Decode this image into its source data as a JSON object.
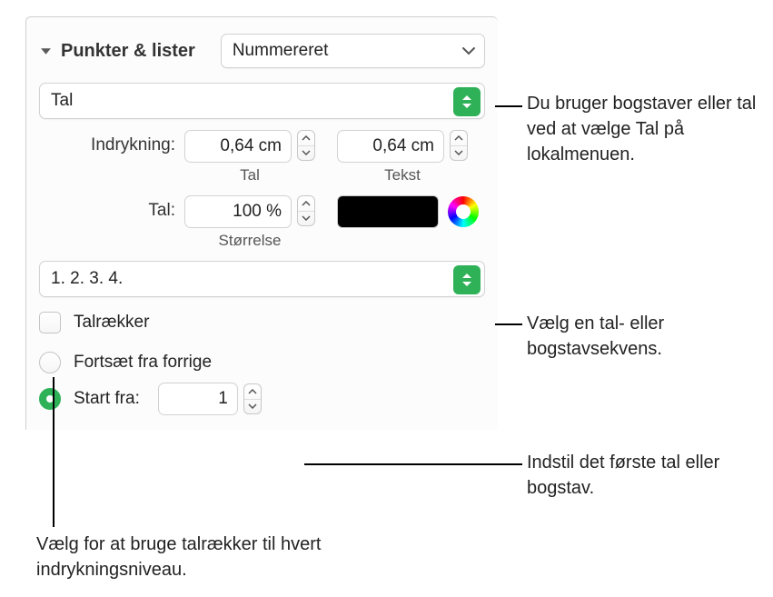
{
  "header": {
    "title": "Punkter & lister",
    "style_popup": "Nummereret"
  },
  "type_popup": "Tal",
  "indent": {
    "label": "Indrykning:",
    "number_value": "0,64 cm",
    "number_sublabel": "Tal",
    "text_value": "0,64 cm",
    "text_sublabel": "Tekst"
  },
  "number": {
    "label": "Tal:",
    "size_value": "100 %",
    "size_sublabel": "Størrelse"
  },
  "format_popup": "1. 2. 3. 4.",
  "tiered_checkbox_label": "Talrækker",
  "radio_continue_label": "Fortsæt fra forrige",
  "radio_start_label": "Start fra:",
  "start_from_value": "1",
  "callouts": {
    "top": "Du bruger bogstaver eller tal ved at vælge Tal på lokalmenuen.",
    "middle": "Vælg en tal- eller bogstavsekvens.",
    "bottom_right": "Indstil det første tal eller bogstav.",
    "bottom_left": "Vælg for at bruge talrækker til hvert indrykningsniveau."
  }
}
